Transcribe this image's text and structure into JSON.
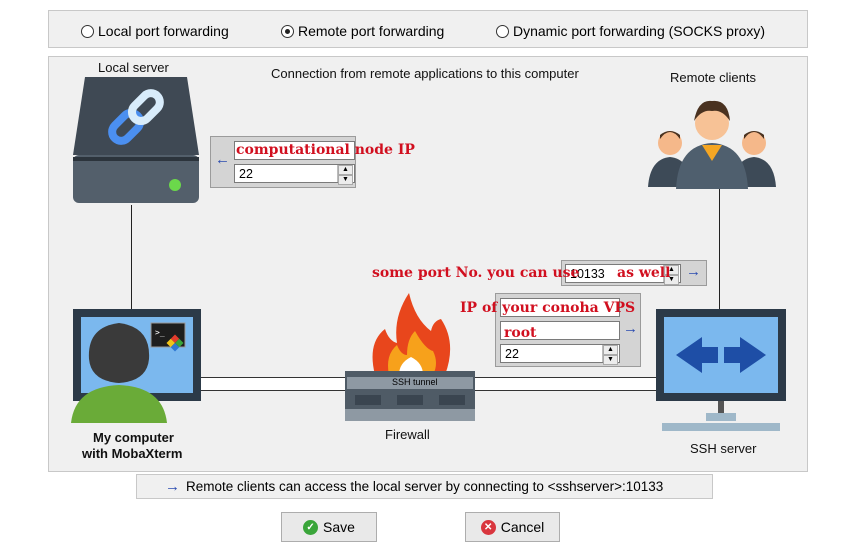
{
  "modes": [
    {
      "label": "Local port forwarding",
      "selected": false
    },
    {
      "label": "Remote port forwarding",
      "selected": true
    },
    {
      "label": "Dynamic port forwarding (SOCKS proxy)",
      "selected": false
    }
  ],
  "diagram": {
    "caption": "Connection from remote applications to this computer",
    "local_server_label": "Local server",
    "remote_clients_label": "Remote clients",
    "my_computer_label_1": "My computer",
    "my_computer_label_2": "with MobaXterm",
    "firewall_label": "Firewall",
    "ssh_tunnel_label": "SSH tunnel",
    "ssh_server_label": "SSH server"
  },
  "local_server_fields": {
    "host_value": "",
    "port_value": "22"
  },
  "remote_port_field": {
    "port_value": "10133"
  },
  "ssh_server_fields": {
    "host_value": "",
    "user_value": "",
    "port_value": "22"
  },
  "annotations": {
    "computational_node_ip": "computational node IP",
    "some_port_prefix": "some port No. you can use",
    "some_port_suffix": "as well",
    "vps_ip": "IP of your conoha VPS",
    "root": "root"
  },
  "info_text": "Remote clients can access the local server by connecting to <sshserver>:10133",
  "buttons": {
    "save_label": "Save",
    "cancel_label": "Cancel"
  },
  "colors": {
    "accent_blue": "#2a4bb0",
    "annotation_red": "#d10f1f",
    "save_green": "#3aa53a",
    "cancel_red": "#d9363e"
  },
  "icons": {
    "local_server": "server-chain-icon",
    "remote_clients": "people-group-icon",
    "my_computer": "user-monitor-icon",
    "firewall": "firewall-icon",
    "ssh_server": "ssh-server-icon"
  }
}
